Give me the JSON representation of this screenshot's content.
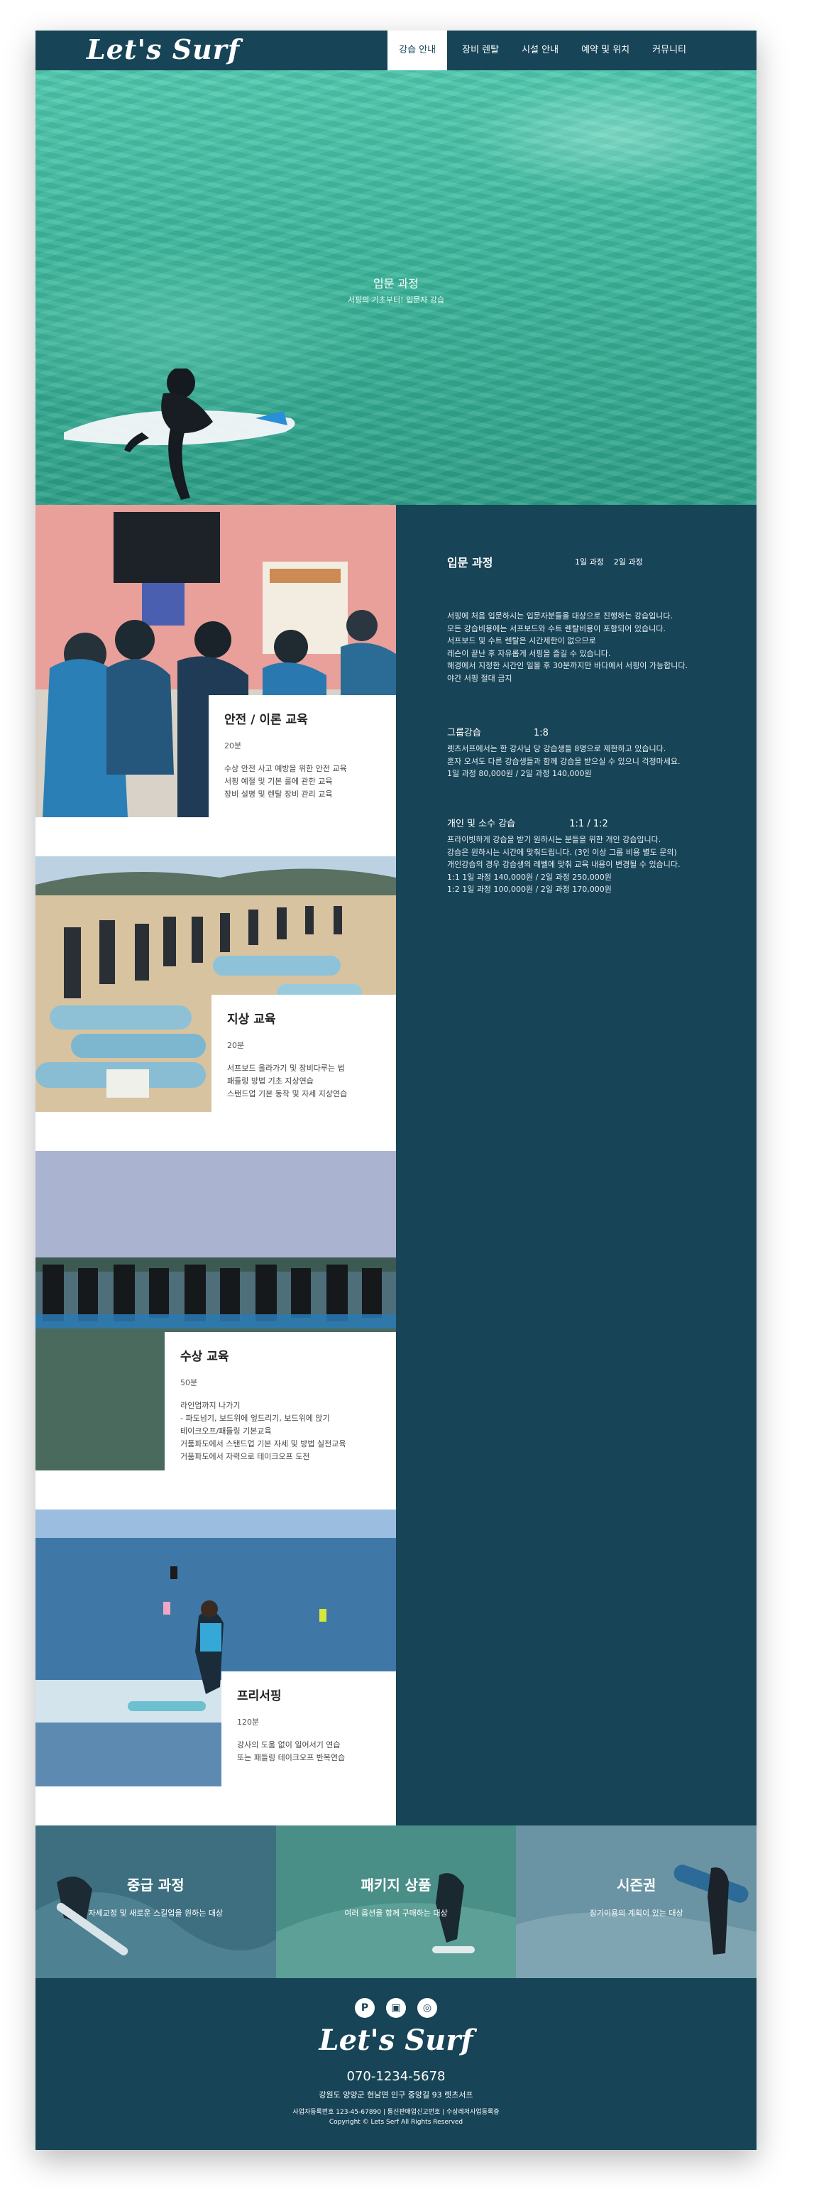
{
  "nav": {
    "logo": "Let's Surf",
    "items": [
      {
        "label": "강습 안내",
        "active": true
      },
      {
        "label": "장비 렌탈",
        "active": false
      },
      {
        "label": "시설 안내",
        "active": false
      },
      {
        "label": "예약 및 위치",
        "active": false
      },
      {
        "label": "커뮤니티",
        "active": false
      }
    ]
  },
  "hero": {
    "title": "입문 과정",
    "subtitle": "서핑의 기초부터! 입문자 강습"
  },
  "lessons": [
    {
      "title": "안전 / 이론 교육",
      "duration": "20분",
      "lines": [
        "수상 안전 사고 예방을 위한 안전 교육",
        "서핑 예절 및 기본 룰에 관한 교육",
        "장비 설명 및 렌탈 장비 관리 교육"
      ]
    },
    {
      "title": "지상 교육",
      "duration": "20분",
      "lines": [
        "서프보드 올라가기 및 장비다루는 법",
        "패들링 방법 기초 지상연습",
        "스탠드업 기본 동작 및 자세 지상연습"
      ]
    },
    {
      "title": "수상 교육",
      "duration": "50분",
      "lines": [
        "라인업까지 나가기",
        "- 파도넘기, 보드위에 엎드리기, 보드위에 앉기",
        "테이크오프/패들링 기본교육",
        "거품파도에서 스탠드업 기본 자세 및 방법 실전교육",
        "거품파도에서 자력으로 테이크오프 도전"
      ]
    },
    {
      "title": "프리서핑",
      "duration": "120분",
      "lines": [
        "강사의 도움 없이 일어서기 연습",
        "또는 패들링 테이크오프 반복연습"
      ]
    }
  ],
  "course": {
    "title": "입문 과정",
    "tabs": [
      "1일 과정",
      "2일 과정"
    ],
    "intro": [
      "서핑에 처음 입문하시는 입문자분들을 대상으로 진행하는 강습입니다.",
      "모든 강습비용에는 서프보드와 수트 렌탈비용이 포함되어 있습니다.",
      "서프보드 및 수트 렌탈은 시간제한이 없으므로",
      "레슨이 끝난 후 자유롭게 서핑을 즐길 수 있습니다.",
      "해경에서 지정한 시간인 일몰 후 30분까지만 바다에서 서핑이 가능합니다.",
      "야간 서핑 절대 금지"
    ],
    "group": {
      "name": "그룹강습",
      "ratio": "1:8",
      "lines": [
        "렛츠서프에서는 한 강사님 당 강습생들 8명으로 제한하고 있습니다.",
        "혼자 오셔도 다른 강습생들과 함께 강습을 받으실 수 있으니 걱정마세요.",
        "1일 과정 80,000원 / 2일 과정 140,000원"
      ]
    },
    "private": {
      "name": "개인 및 소수 강습",
      "ratio": "1:1 / 1:2",
      "lines": [
        "프라이빗하게 강습을 받기 원하시는 분들을 위한 개인 강습입니다.",
        "강습은 원하시는 시간에 맞춰드립니다. (3인 이상 그룹 비용 별도 문의)",
        "개인강습의 경우 강습생의 레벨에 맞춰 교육 내용이 변경될 수 있습니다.",
        "1:1 1일 과정 140,000원 / 2일 과정 250,000원",
        "1:2 1일 과정 100,000원 / 2일 과정 170,000원"
      ]
    }
  },
  "banners": [
    {
      "title": "중급 과정",
      "subtitle": "자세교정 및 새로운 스킬업을 원하는 대상",
      "color": "#3d6f80"
    },
    {
      "title": "패키지 상품",
      "subtitle": "여러 옵션을 함께 구매하는 대상",
      "color": "#4a8f87"
    },
    {
      "title": "시즌권",
      "subtitle": "장기이용의 계획이 있는 대상",
      "color": "#6a94a3"
    }
  ],
  "footer": {
    "logo": "Let's Surf",
    "socials": [
      "blog-icon",
      "talk-icon",
      "instagram-icon"
    ],
    "phone": "070-1234-5678",
    "address": "강원도 양양군 현남면 인구 중앙길 93 렛츠서프",
    "registration": "사업자등록번호 123-45-67890  |  통신판매업신고번호  |  수상레저사업등록증",
    "copyright": "Copyright © Lets Serf All Rights Reserved"
  },
  "colors": {
    "brand": "#174457",
    "accent": "#ffffff",
    "water": "#3bb69b"
  }
}
